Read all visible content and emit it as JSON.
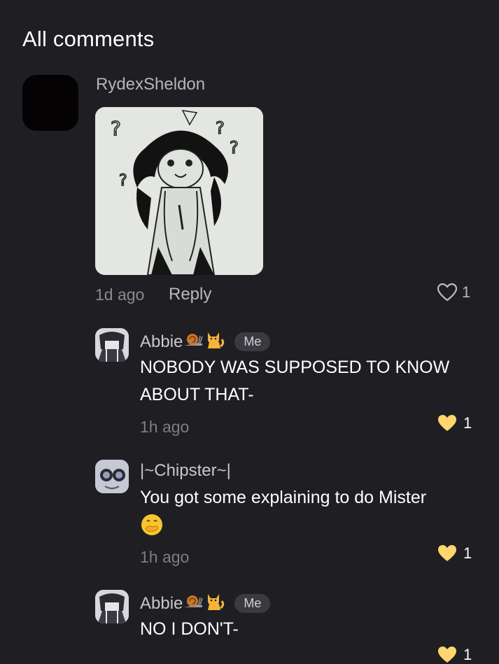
{
  "header": {
    "title": "All comments"
  },
  "main_comment": {
    "username": "RydexSheldon",
    "time": "1d ago",
    "reply_label": "Reply",
    "like_count": "1",
    "image_alt": "drawing-sketch"
  },
  "replies": [
    {
      "username": "Abbie",
      "badge": "Me",
      "text": "NOBODY WAS SUPPOSED TO KNOW ABOUT THAT-",
      "time": "1h ago",
      "like_count": "1"
    },
    {
      "username": "|~Chipster~|",
      "badge": "",
      "text": "You got some explaining to do Mister",
      "time": "1h ago",
      "like_count": "1"
    },
    {
      "username": "Abbie",
      "badge": "Me",
      "text": "NO I DON'T-",
      "time": "",
      "like_count": "1"
    }
  ],
  "colors": {
    "background": "#1f1f23",
    "like_filled": "#ffd66e",
    "badge_bg": "#3a3a40"
  }
}
